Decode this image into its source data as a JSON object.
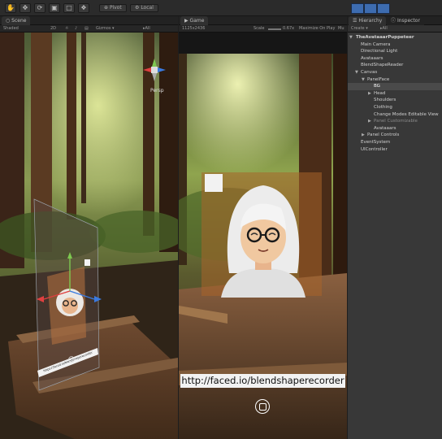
{
  "toolbar": {
    "pivot_label": "Pivot",
    "local_label": "Local"
  },
  "scene": {
    "tab_label": "Scene",
    "shading_mode": "Shaded",
    "mode_2d": "2D",
    "gizmos_label": "Gizmos ▾",
    "search_placeholder": "▸All",
    "persp_label": "Persp",
    "card_caption": "https://faced.io/blendshaperecorder"
  },
  "game": {
    "tab_label": "Game",
    "resolution": "1125x2436",
    "scale_label": "Scale",
    "scale_value": "0.67x",
    "maximize_label": "Maximize On Play",
    "mute_label": "Mu",
    "url_text": "http://faced.io/blendshaperecorder"
  },
  "hierarchy": {
    "tab_label": "Hierarchy",
    "inspector_tab_label": "Inspector",
    "create_label": "Create ▾",
    "search_placeholder": "▸All",
    "items": [
      {
        "label": "TheAvataaarPuppeteer"
      },
      {
        "label": "Main Camera"
      },
      {
        "label": "Directional Light"
      },
      {
        "label": "Avataaars"
      },
      {
        "label": "BlendShapeReader"
      },
      {
        "label": "Canvas"
      },
      {
        "label": "PanelFace"
      },
      {
        "label": "BG"
      },
      {
        "label": "Head"
      },
      {
        "label": "Shoulders"
      },
      {
        "label": "Clothing"
      },
      {
        "label": "Change Modes Editable View"
      },
      {
        "label": "Panel Customizable"
      },
      {
        "label": "Avataaars"
      },
      {
        "label": "Panel Controls"
      },
      {
        "label": "EventSystem"
      },
      {
        "label": "UIController"
      }
    ]
  },
  "colors": {
    "accent_play": "#3d6cb0",
    "selection": "#4a4a4a",
    "panel_bg": "#383838"
  }
}
